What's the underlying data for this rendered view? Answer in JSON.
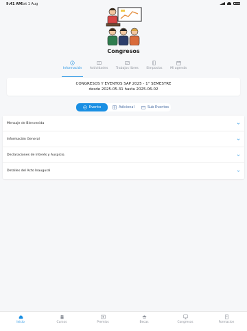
{
  "status": {
    "time": "9:41 AM",
    "date": "Sat 1 Aug"
  },
  "page": {
    "title": "Congresos"
  },
  "tabs": [
    {
      "label": "Información",
      "icon": "info-icon",
      "active": true
    },
    {
      "label": "Actividades",
      "icon": "activities-icon"
    },
    {
      "label": "Trabajos libres",
      "icon": "chart-icon"
    },
    {
      "label": "Simposios",
      "icon": "book-icon"
    },
    {
      "label": "Mi agenda",
      "icon": "calendar-icon"
    }
  ],
  "event_card": {
    "line1": "CONGRESOS Y EVENTOS SAP 2025 - 1° SEMESTRE",
    "line2": "desde 2025-05-31 hasta 2025-06-02"
  },
  "segments": [
    {
      "label": "Evento",
      "icon": "check-circle-icon",
      "active": true
    },
    {
      "label": "Adicional",
      "icon": "grid-icon"
    },
    {
      "label": "Sub Eventos",
      "icon": "calendar-icon"
    }
  ],
  "accordion": [
    {
      "label": "Mensaje de Bienvenida"
    },
    {
      "label": "Información General"
    },
    {
      "label": "Declaraciones de Interés y Auspicio."
    },
    {
      "label": "Detalles del Acto Inaugural"
    }
  ],
  "bottom_nav": [
    {
      "label": "Inicio",
      "icon": "home-icon",
      "active": true
    },
    {
      "label": "Cursos",
      "icon": "people-icon"
    },
    {
      "label": "Premios",
      "icon": "award-icon"
    },
    {
      "label": "Becas",
      "icon": "grad-icon"
    },
    {
      "label": "Congresos",
      "icon": "presentation-icon"
    },
    {
      "label": "Formacion",
      "icon": "notebook-icon"
    }
  ],
  "colors": {
    "accent": "#1a8fe3",
    "background": "#f6f7f9"
  }
}
